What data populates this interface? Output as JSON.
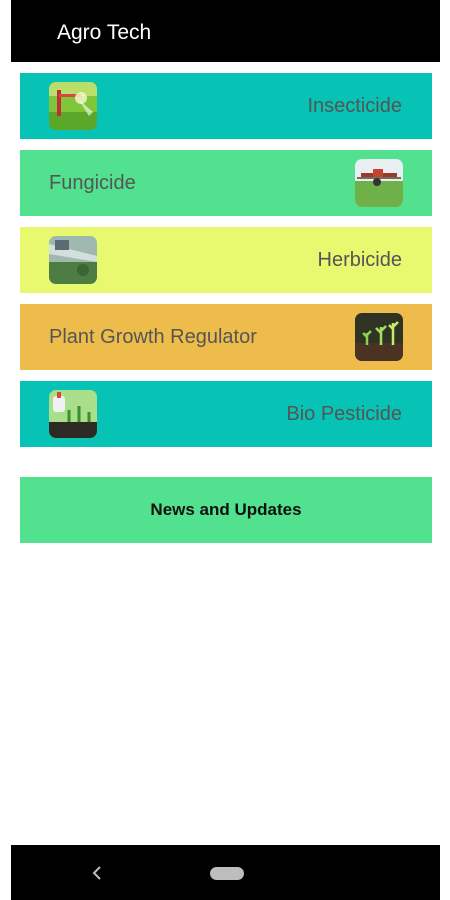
{
  "app": {
    "title": "Agro Tech"
  },
  "categories": [
    {
      "label": "Insecticide",
      "icon": "crop-sprayer-icon",
      "color": "#06c3b5"
    },
    {
      "label": "Fungicide",
      "icon": "tractor-field-icon",
      "color": "#52e18e"
    },
    {
      "label": "Herbicide",
      "icon": "weed-spray-icon",
      "color": "#e8f96f"
    },
    {
      "label": "Plant Growth Regulator",
      "icon": "seedlings-icon",
      "color": "#eebc4b"
    },
    {
      "label": "Bio Pesticide",
      "icon": "bio-sprout-icon",
      "color": "#06c3b5"
    }
  ],
  "news": {
    "label": "News and Updates",
    "color": "#52e18e"
  },
  "nav": {
    "back_icon": "back-chevron-icon",
    "home_icon": "home-pill-icon"
  }
}
